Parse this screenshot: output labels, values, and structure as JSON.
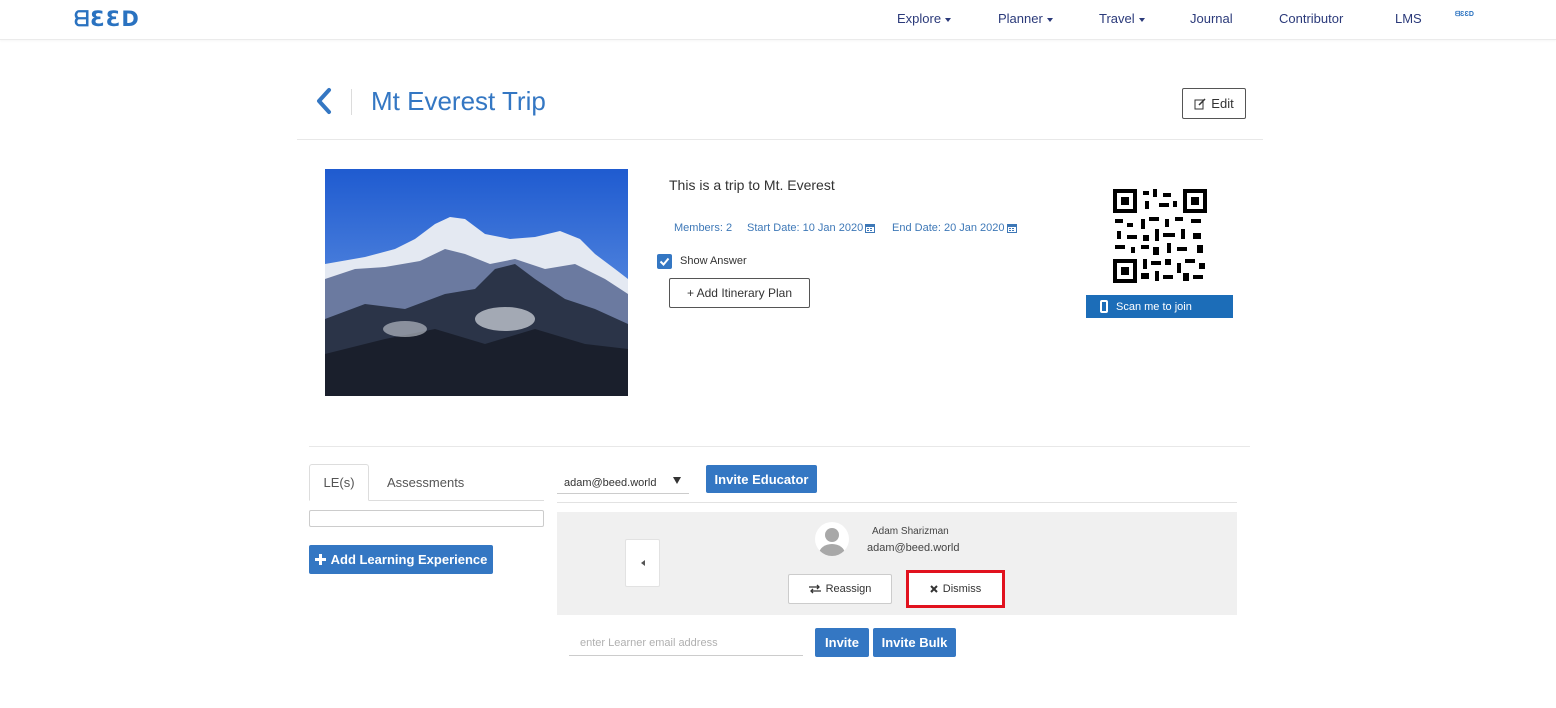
{
  "brand": {
    "logo_text": "ᗺƐƐD",
    "mini_logo_text": "ᗺƐƐD"
  },
  "nav": {
    "items": [
      {
        "label": "Explore",
        "has_dropdown": true
      },
      {
        "label": "Planner",
        "has_dropdown": true
      },
      {
        "label": "Travel",
        "has_dropdown": true
      },
      {
        "label": "Journal",
        "has_dropdown": false
      },
      {
        "label": "Contributor",
        "has_dropdown": false
      },
      {
        "label": "LMS",
        "has_dropdown": false
      }
    ]
  },
  "trip": {
    "title": "Mt Everest Trip",
    "edit_label": "Edit",
    "description": "This is a trip to Mt. Everest",
    "members": "Members: 2",
    "start_date": "Start Date: 10 Jan 2020",
    "end_date": "End Date: 20 Jan 2020",
    "show_answer_label": "Show Answer",
    "show_answer_checked": true,
    "add_itinerary_label": "+ Add Itinerary Plan",
    "scan_label": "Scan me to join"
  },
  "tabs": [
    {
      "label": "LE(s)",
      "active": true
    },
    {
      "label": "Assessments",
      "active": false
    }
  ],
  "add_le_label": "Add Learning Experience",
  "educator": {
    "selected_email": "adam@beed.world",
    "invite_label": "Invite Educator",
    "name": "Adam Sharizman",
    "email": "adam@beed.world",
    "reassign_label": "Reassign",
    "dismiss_label": "Dismiss"
  },
  "learner": {
    "placeholder": "enter Learner email address",
    "invite_label": "Invite",
    "invite_bulk_label": "Invite Bulk"
  },
  "colors": {
    "accent": "#3477c3",
    "nav_text": "#2b3a7a",
    "scan_banner": "#1c6db8",
    "highlight": "#e1121e"
  }
}
